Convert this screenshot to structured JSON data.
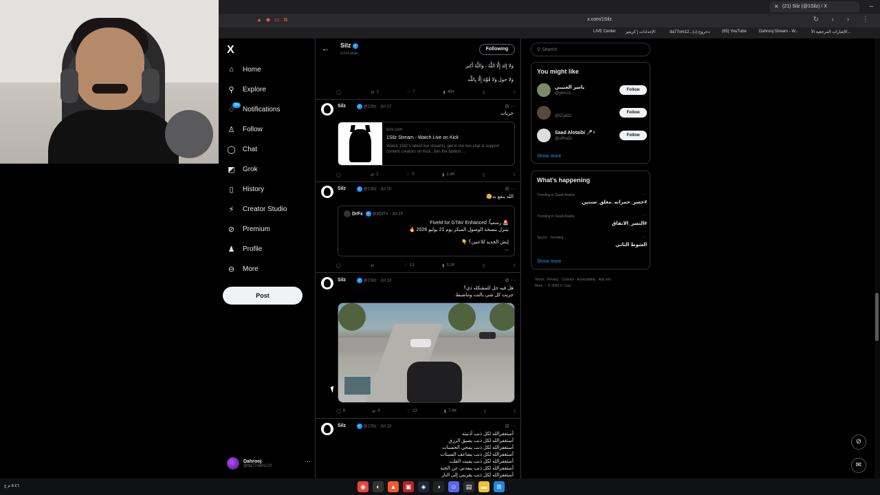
{
  "browser": {
    "tab_title": "(21) Silz (@1Silz) / X",
    "url": "x.com/1Silz",
    "bookmarks": [
      "LIVE Center",
      "الإعدادات | كريتيز",
      "da77om12...(د) ذحروج",
      "(65) YouTube",
      "Dahrooj Stream - W...",
      "الإشارات المرجعية الأ..."
    ]
  },
  "nav": {
    "logo": "X",
    "items": [
      {
        "label": "Home",
        "icon": "home-icon"
      },
      {
        "label": "Explore",
        "icon": "search-icon"
      },
      {
        "label": "Notifications",
        "icon": "bell-icon",
        "badge": "20+"
      },
      {
        "label": "Follow",
        "icon": "person-plus-icon"
      },
      {
        "label": "Chat",
        "icon": "chat-icon"
      },
      {
        "label": "Grok",
        "icon": "grok-icon"
      },
      {
        "label": "History",
        "icon": "bookmark-icon"
      },
      {
        "label": "Creator Studio",
        "icon": "creator-icon"
      },
      {
        "label": "Premium",
        "icon": "premium-icon"
      },
      {
        "label": "Profile",
        "icon": "person-icon"
      },
      {
        "label": "More",
        "icon": "more-circle-icon"
      }
    ],
    "post_label": "Post",
    "account": {
      "name": "Dahrooj",
      "handle": "@da77oom123",
      "more": "···"
    }
  },
  "timeline": {
    "header": {
      "name": "Silz",
      "posts": "3,414 posts",
      "following_label": "Following"
    },
    "prev_tweet": {
      "lines": [
        "وَلا إِلهَ إِلَّا اللَّهُ ، وَاللَّهُ أَكبر",
        "وَلا حول وَلا قُوَّةَ إِلَّا بِاللَّه"
      ],
      "actions": {
        "reply": "",
        "repost": "2",
        "like": "7",
        "views": "484"
      }
    },
    "tweets": [
      {
        "name": "Silz",
        "handle": "@1Silz",
        "date": "Jul 17",
        "text": "خزنات",
        "card": {
          "domain": "kick.com",
          "title": "1Silz Stream - Watch Live on Kick",
          "desc": "Watch 1Silz's latest live streams, get in the live chat & support content creators on Kick. Join the fastest ..."
        },
        "actions": {
          "reply": "",
          "repost": "2",
          "like": "5",
          "views": "2.4K"
        }
      },
      {
        "name": "Silz",
        "handle": "@1Silz",
        "date": "Jul 15",
        "text": "الله ينفع به🤨",
        "quote": {
          "name": "DrFx",
          "handle": "@xlDrFx",
          "date": "Jul 15",
          "lines": [
            "🚨 رسمياً: FiveM for GTAV Enhanced",
            "بتنزل بنسخة الوصول المبكر يوم 21 يوليو 2026 🔥",
            "",
            "إيش الجديد للاعبين؟ 👇",
            "..."
          ]
        },
        "actions": {
          "reply": "",
          "repost": "",
          "like": "13",
          "views": "3.2K"
        }
      },
      {
        "name": "Silz",
        "handle": "@1Silz",
        "date": "Jul 13",
        "lines": [
          "هل فيه حل للمشكله ذي؟",
          "جربت كل شي بالنت وماضبط."
        ],
        "actions": {
          "reply": "8",
          "repost": "4",
          "like": "23",
          "views": "7.4K"
        }
      },
      {
        "name": "Silz",
        "handle": "@1Silz",
        "date": "Jul 13",
        "lines": [
          "أستغفرالله لكل ذنب أذنبته",
          "أستغفرالله لكل ذنب يضيق الرزق",
          "أستغفرالله لكل ذنب يمحي الحسنات",
          "أستغفرالله لكل ذنب يضاعف السيئات",
          "أستغفرالله لكل ذنب يميت القلب",
          "أستغفرالله لكل ذنب يبعدني عن الجنة",
          "أستغفرالله لكل ذنب يقربني إلى النار"
        ]
      }
    ]
  },
  "right": {
    "search_placeholder": "Search",
    "you_might_like": {
      "title": "You might like",
      "items": [
        {
          "name": "ياسر العتيبي",
          "handle": "@ybm1z",
          "follow": "Follow"
        },
        {
          "name": "",
          "handle": "@lZyad2",
          "follow": "Follow"
        },
        {
          "name": "Saad Alotaibi 🎤⚡",
          "handle": "@s8haDi",
          "follow": "Follow"
        }
      ],
      "show_more": "Show more"
    },
    "happening": {
      "title": "What’s happening",
      "trends": [
        {
          "context": "Trending in Saudi Arabia",
          "topic": "#خسر_حمرانه_مغلق_سنتين"
        },
        {
          "context": "Trending in Saudi Arabia",
          "topic": "#النصر_الاتفاق"
        },
        {
          "context": "Sports · Trending",
          "topic": "الشوط الثاني"
        }
      ],
      "show_more": "Show more"
    },
    "footer": [
      "Terms",
      "Privacy",
      "Cookies",
      "Accessibility",
      "Ads info",
      "More ···",
      "© 2025 X Corp."
    ]
  },
  "taskbar": {
    "system": "٥:٤٦ م  ع"
  },
  "colors": {
    "accent": "#1d9bf0",
    "bg": "#000000",
    "border": "#2f3336",
    "muted": "#71767b"
  }
}
